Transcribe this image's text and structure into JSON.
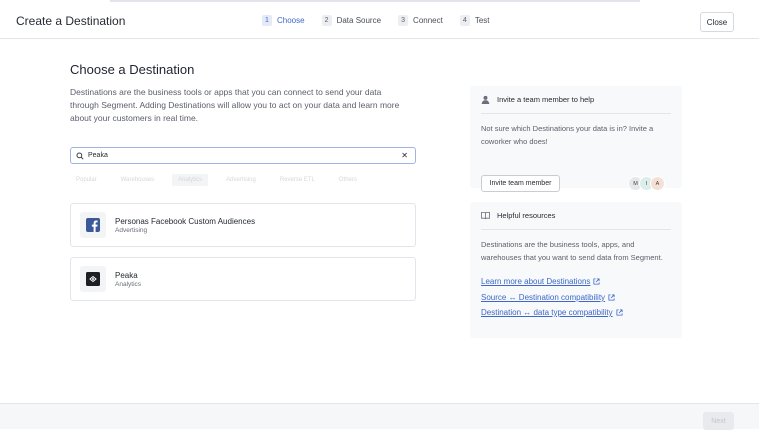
{
  "header": {
    "title": "Create a Destination",
    "close_label": "Close",
    "steps": [
      {
        "num": "1",
        "label": "Choose"
      },
      {
        "num": "2",
        "label": "Data Source"
      },
      {
        "num": "3",
        "label": "Connect"
      },
      {
        "num": "4",
        "label": "Test"
      }
    ],
    "active_step": 0
  },
  "main": {
    "heading": "Choose a Destination",
    "description": "Destinations are the business tools or apps that you can connect to send your data through Segment. Adding Destinations will allow you to act on your data and learn more about your customers in real time.",
    "search": {
      "value": "Peaka"
    },
    "filters": [
      "Popular",
      "Warehouses",
      "Analytics",
      "Advertising",
      "Reverse ETL",
      "Others"
    ],
    "active_filter": 2,
    "results": [
      {
        "name": "Personas Facebook Custom Audiences",
        "category": "Advertising",
        "icon": "facebook-icon"
      },
      {
        "name": "Peaka",
        "category": "Analytics",
        "icon": "peaka-icon"
      }
    ]
  },
  "sidebar": {
    "invite": {
      "title": "Invite a team member to help",
      "text": "Not sure which Destinations your data is in? Invite a coworker who does!",
      "button_label": "Invite team member",
      "avatars": [
        {
          "initial": "M",
          "color": "#e6e8ec"
        },
        {
          "initial": "I",
          "color": "#dbeee9"
        },
        {
          "initial": "A",
          "color": "#f5e0d6"
        }
      ]
    },
    "resources": {
      "title": "Helpful resources",
      "text": "Destinations are the business tools, apps, and warehouses that you want to send data from Segment.",
      "links": [
        "Learn more about Destinations",
        "Source ↔ Destination compatibility",
        "Destination ↔ data type compatibility"
      ]
    }
  },
  "footer": {
    "next_label": "Next"
  },
  "colors": {
    "accent": "#3d67c9",
    "facebook": "#3b5998"
  }
}
